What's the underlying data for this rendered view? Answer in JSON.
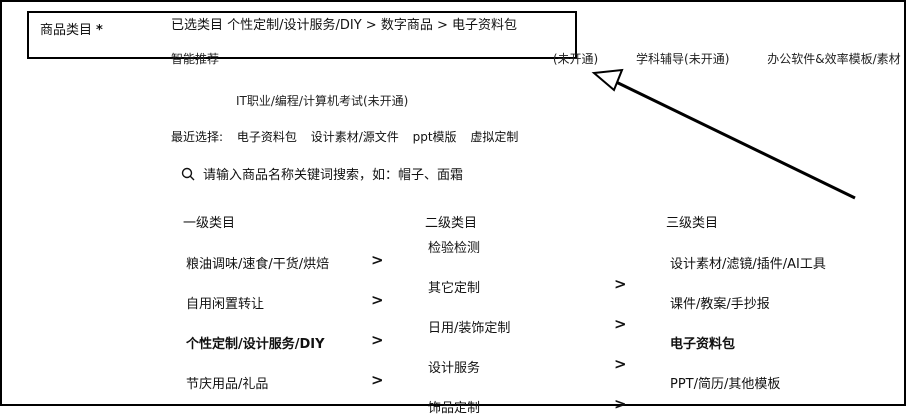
{
  "field_label": "商品类目",
  "required_mark": "*",
  "selected_path": "已选类目  个性定制/设计服务/DIY > 数字商品 > 电子资料包",
  "smart_recommend": {
    "label": "智能推荐",
    "items": [
      "(未开通)",
      "学科辅导(未开通)",
      "办公软件&效率模板/素材"
    ],
    "line2": "IT职业/编程/计算机考试(未开通)"
  },
  "recent": {
    "label": "最近选择:",
    "items": [
      "电子资料包",
      "设计素材/源文件",
      "ppt模版",
      "虚拟定制"
    ]
  },
  "search": {
    "placeholder": "请输入商品名称关键词搜索，如：帽子、面霜"
  },
  "columns": {
    "level1": {
      "header": "一级类目",
      "items": [
        "粮油调味/速食/干货/烘焙",
        "自用闲置转让",
        "个性定制/设计服务/DIY",
        "节庆用品/礼品"
      ]
    },
    "level2": {
      "header": "二级类目",
      "items": [
        "检验检测",
        "其它定制",
        "日用/装饰定制",
        "设计服务",
        "饰品定制"
      ]
    },
    "level3": {
      "header": "三级类目",
      "items": [
        "设计素材/滤镜/插件/AI工具",
        "课件/教案/手抄报",
        "电子资料包",
        "PPT/简历/其他模板"
      ]
    }
  },
  "chevron": ">"
}
